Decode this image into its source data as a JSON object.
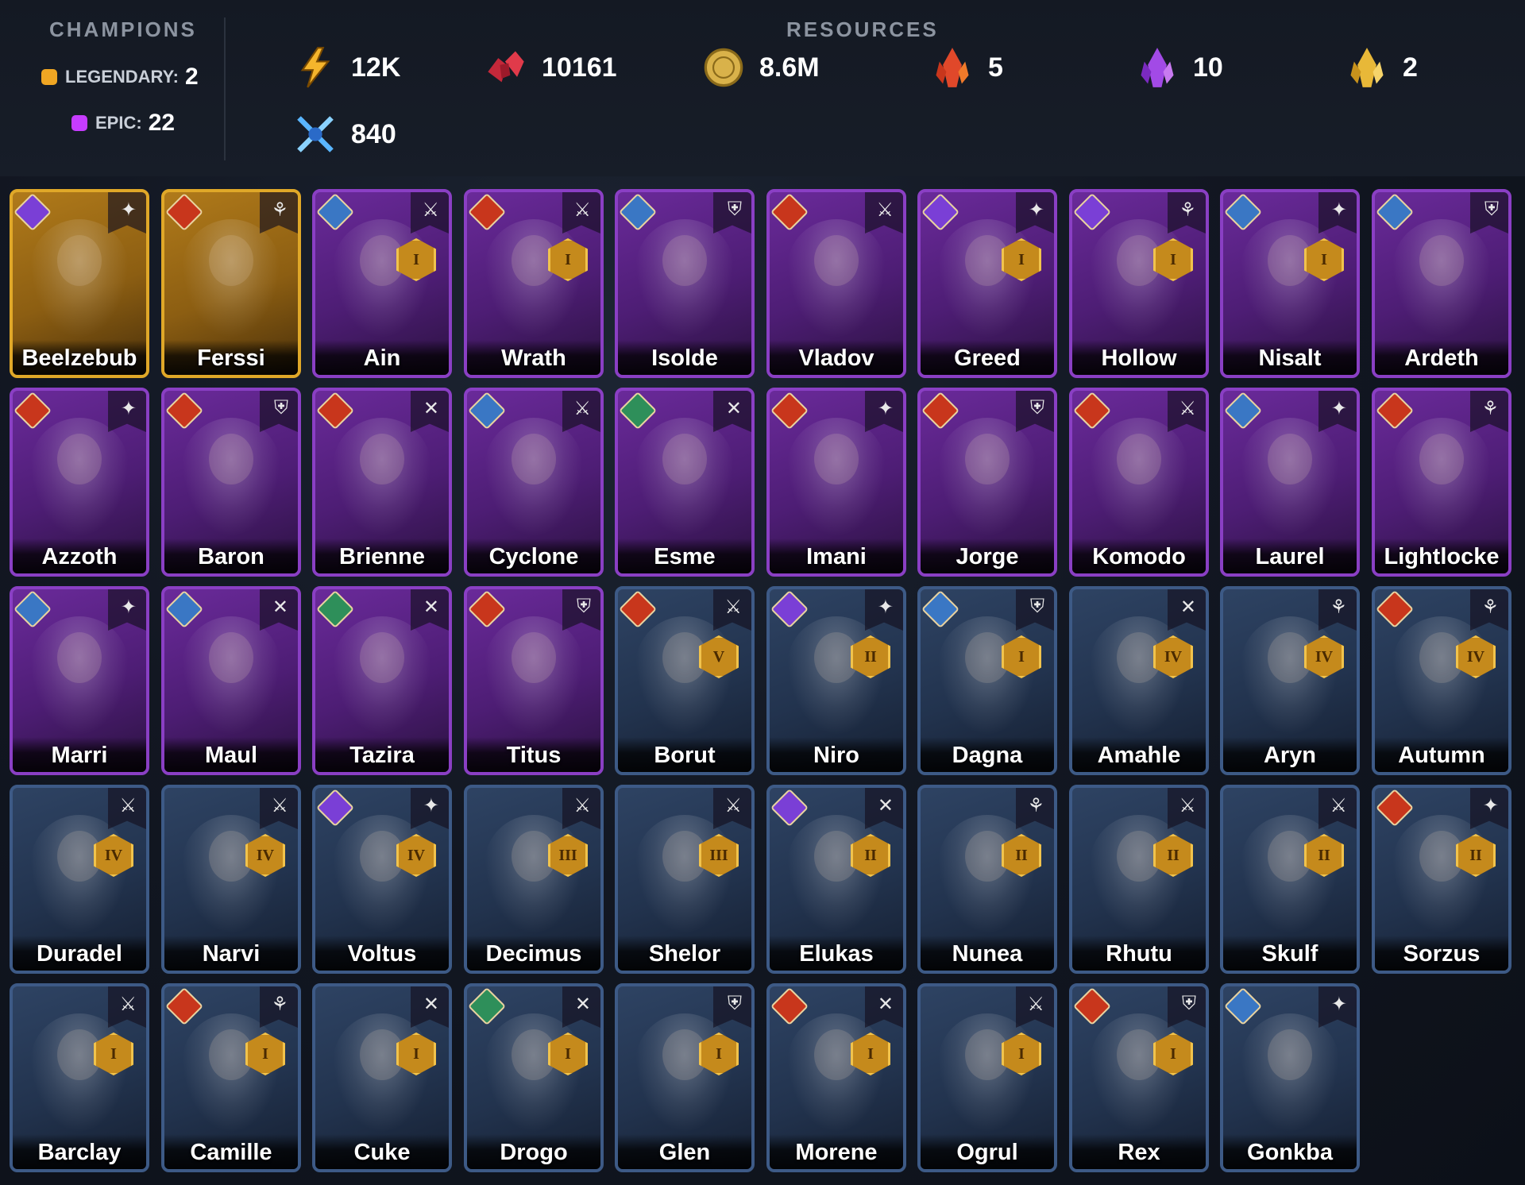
{
  "header": {
    "champions_title": "CHAMPIONS",
    "resources_title": "RESOURCES",
    "legendary_label": "LEGENDARY:",
    "legendary_count": "2",
    "epic_label": "EPIC:",
    "epic_count": "22",
    "colors": {
      "legendary": "#f0a623",
      "epic": "#c63cff"
    },
    "resources": [
      {
        "icon": "energy-bolt-icon",
        "value": "12K"
      },
      {
        "icon": "gem-shards-icon",
        "value": "10161"
      },
      {
        "icon": "gold-coin-icon",
        "value": "8.6M"
      },
      {
        "icon": "red-crystal-icon",
        "value": "5"
      },
      {
        "icon": "purple-crystal-icon",
        "value": "10"
      },
      {
        "icon": "gold-crystal-icon",
        "value": "2"
      },
      {
        "icon": "arena-swords-icon",
        "value": "840"
      }
    ]
  },
  "champions": [
    {
      "name": "Beelzebub",
      "rarity": "legendary",
      "affinity": "magic",
      "role": "sword-star"
    },
    {
      "name": "Ferssi",
      "rarity": "legendary",
      "affinity": "force",
      "role": "hands"
    },
    {
      "name": "Ain",
      "rarity": "epic",
      "affinity": "awaken",
      "role": "sword",
      "rank": "I"
    },
    {
      "name": "Wrath",
      "rarity": "epic",
      "affinity": "force",
      "role": "sword",
      "rank": "I"
    },
    {
      "name": "Isolde",
      "rarity": "epic",
      "affinity": "awaken",
      "role": "shield"
    },
    {
      "name": "Vladov",
      "rarity": "epic",
      "affinity": "force",
      "role": "sword"
    },
    {
      "name": "Greed",
      "rarity": "epic",
      "affinity": "magic",
      "role": "sword-star",
      "rank": "I"
    },
    {
      "name": "Hollow",
      "rarity": "epic",
      "affinity": "magic",
      "role": "hands",
      "rank": "I"
    },
    {
      "name": "Nisalt",
      "rarity": "epic",
      "affinity": "awaken",
      "role": "sword-star",
      "rank": "I"
    },
    {
      "name": "Ardeth",
      "rarity": "epic",
      "affinity": "awaken",
      "role": "shield"
    },
    {
      "name": "Azzoth",
      "rarity": "epic",
      "affinity": "force",
      "role": "sword-star"
    },
    {
      "name": "Baron",
      "rarity": "epic",
      "affinity": "force",
      "role": "shield"
    },
    {
      "name": "Brienne",
      "rarity": "epic",
      "affinity": "force",
      "role": "crossed-swords"
    },
    {
      "name": "Cyclone",
      "rarity": "epic",
      "affinity": "awaken",
      "role": "sword"
    },
    {
      "name": "Esme",
      "rarity": "epic",
      "affinity": "spirit",
      "role": "crossed-swords"
    },
    {
      "name": "Imani",
      "rarity": "epic",
      "affinity": "force",
      "role": "sword-star"
    },
    {
      "name": "Jorge",
      "rarity": "epic",
      "affinity": "force",
      "role": "shield"
    },
    {
      "name": "Komodo",
      "rarity": "epic",
      "affinity": "force",
      "role": "sword"
    },
    {
      "name": "Laurel",
      "rarity": "epic",
      "affinity": "awaken",
      "role": "sword-star"
    },
    {
      "name": "Lightlocke",
      "rarity": "epic",
      "affinity": "force",
      "role": "hands"
    },
    {
      "name": "Marri",
      "rarity": "epic",
      "affinity": "awaken",
      "role": "sword-star"
    },
    {
      "name": "Maul",
      "rarity": "epic",
      "affinity": "awaken",
      "role": "crossed-swords"
    },
    {
      "name": "Tazira",
      "rarity": "epic",
      "affinity": "spirit",
      "role": "crossed-swords"
    },
    {
      "name": "Titus",
      "rarity": "epic",
      "affinity": "force",
      "role": "shield"
    },
    {
      "name": "Borut",
      "rarity": "rare",
      "affinity": "force",
      "role": "sword",
      "rank": "V"
    },
    {
      "name": "Niro",
      "rarity": "rare",
      "affinity": "magic",
      "role": "sword-star",
      "rank": "II"
    },
    {
      "name": "Dagna",
      "rarity": "rare",
      "affinity": "awaken",
      "role": "shield",
      "rank": "I"
    },
    {
      "name": "Amahle",
      "rarity": "rare",
      "affinity": "none",
      "role": "crossed-swords",
      "rank": "IV"
    },
    {
      "name": "Aryn",
      "rarity": "rare",
      "affinity": "none",
      "role": "hands",
      "rank": "IV"
    },
    {
      "name": "Autumn",
      "rarity": "rare",
      "affinity": "force",
      "role": "hands",
      "rank": "IV"
    },
    {
      "name": "Duradel",
      "rarity": "rare",
      "affinity": "none",
      "role": "sword",
      "rank": "IV"
    },
    {
      "name": "Narvi",
      "rarity": "rare",
      "affinity": "none",
      "role": "sword",
      "rank": "IV"
    },
    {
      "name": "Voltus",
      "rarity": "rare",
      "affinity": "magic",
      "role": "sword-star",
      "rank": "IV"
    },
    {
      "name": "Decimus",
      "rarity": "rare",
      "affinity": "none",
      "role": "sword",
      "rank": "III"
    },
    {
      "name": "Shelor",
      "rarity": "rare",
      "affinity": "none",
      "role": "sword",
      "rank": "III"
    },
    {
      "name": "Elukas",
      "rarity": "rare",
      "affinity": "magic",
      "role": "crossed-swords",
      "rank": "II"
    },
    {
      "name": "Nunea",
      "rarity": "rare",
      "affinity": "none",
      "role": "hands",
      "rank": "II"
    },
    {
      "name": "Rhutu",
      "rarity": "rare",
      "affinity": "none",
      "role": "sword",
      "rank": "II"
    },
    {
      "name": "Skulf",
      "rarity": "rare",
      "affinity": "none",
      "role": "sword",
      "rank": "II"
    },
    {
      "name": "Sorzus",
      "rarity": "rare",
      "affinity": "force",
      "role": "sword-star",
      "rank": "II"
    },
    {
      "name": "Barclay",
      "rarity": "rare",
      "affinity": "none",
      "role": "sword",
      "rank": "I"
    },
    {
      "name": "Camille",
      "rarity": "rare",
      "affinity": "force",
      "role": "hands",
      "rank": "I"
    },
    {
      "name": "Cuke",
      "rarity": "rare",
      "affinity": "none",
      "role": "crossed-swords",
      "rank": "I"
    },
    {
      "name": "Drogo",
      "rarity": "rare",
      "affinity": "spirit",
      "role": "crossed-swords",
      "rank": "I"
    },
    {
      "name": "Glen",
      "rarity": "rare",
      "affinity": "none",
      "role": "shield",
      "rank": "I"
    },
    {
      "name": "Morene",
      "rarity": "rare",
      "affinity": "force",
      "role": "crossed-swords",
      "rank": "I"
    },
    {
      "name": "Ogrul",
      "rarity": "rare",
      "affinity": "none",
      "role": "sword",
      "rank": "I"
    },
    {
      "name": "Rex",
      "rarity": "rare",
      "affinity": "force",
      "role": "shield",
      "rank": "I"
    },
    {
      "name": "Gonkba",
      "rarity": "rare",
      "affinity": "awaken",
      "role": "sword-star"
    }
  ]
}
